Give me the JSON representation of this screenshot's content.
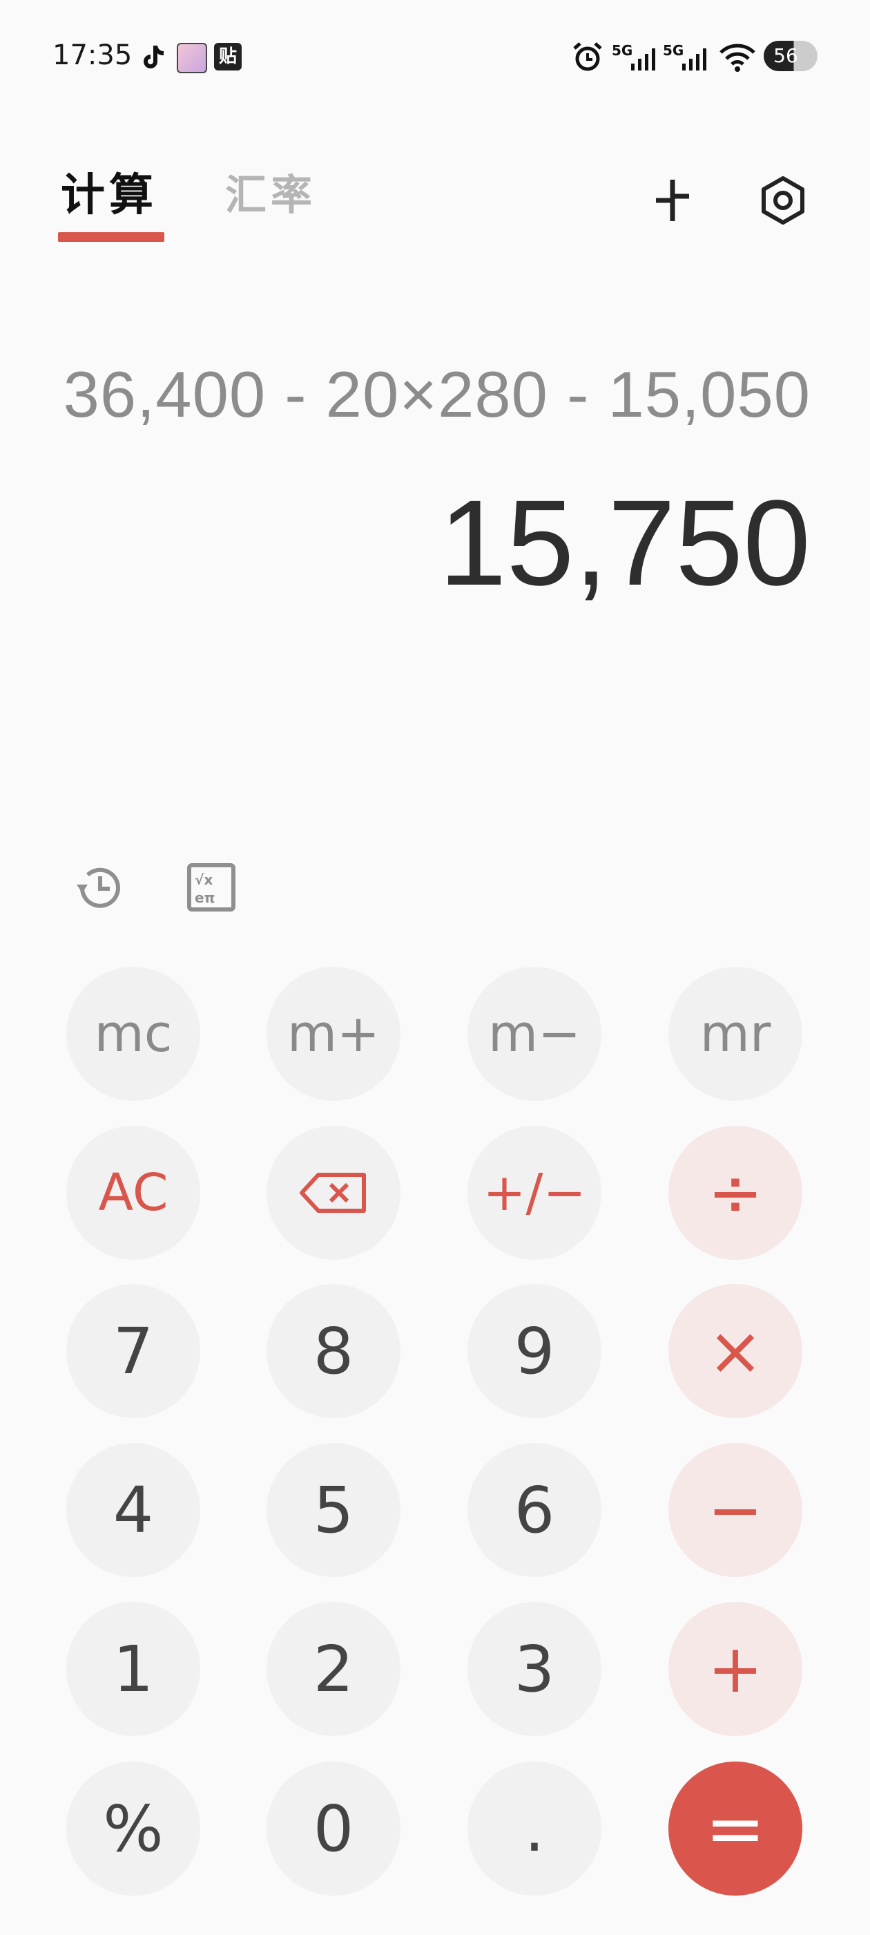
{
  "status_bar": {
    "time": "17:35",
    "apps": [
      "tiktok-icon",
      "game-avatar-icon",
      "tieba-icon"
    ],
    "tieba_label": "贴",
    "network_1": "5G",
    "network_2": "5G",
    "battery_level": "56"
  },
  "tabs": [
    {
      "label": "计算",
      "active": true
    },
    {
      "label": "汇率",
      "active": false
    }
  ],
  "display": {
    "expression": "36,400 - 20×280 - 15,050",
    "result": "15,750"
  },
  "keys": {
    "mc": "mc",
    "m_plus": "m+",
    "m_minus": "m−",
    "mr": "mr",
    "ac": "AC",
    "plus_minus": "+/−",
    "divide": "÷",
    "multiply": "×",
    "minus": "−",
    "plus": "+",
    "equals": "=",
    "seven": "7",
    "eight": "8",
    "nine": "9",
    "four": "4",
    "five": "5",
    "six": "6",
    "one": "1",
    "two": "2",
    "three": "3",
    "percent": "%",
    "zero": "0",
    "dot": "."
  },
  "colors": {
    "accent": "#D9564D",
    "operator_bg": "#F5E8E7",
    "key_bg": "#F1F1F1",
    "background": "#FAFAFA"
  }
}
